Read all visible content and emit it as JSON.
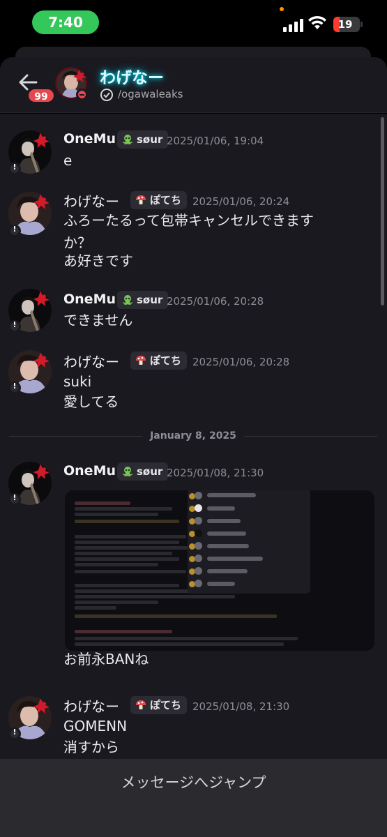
{
  "status_bar": {
    "time": "7:40",
    "battery": "19"
  },
  "header": {
    "back_badge": "99",
    "name": "わげなー",
    "handle": "/ogawaleaks"
  },
  "messages": [
    {
      "user": "OneMu",
      "tag": "søur",
      "timestamp": "2025/01/06, 19:04",
      "lines": [
        "e"
      ]
    },
    {
      "user": "わげなー",
      "tag": "ぽてち",
      "timestamp": "2025/01/06, 20:24",
      "lines": [
        "ふろーたるって包帯キャンセルできます",
        "か？",
        "あ好きです"
      ]
    },
    {
      "user": "OneMu",
      "tag": "søur",
      "timestamp": "2025/01/06, 20:28",
      "lines": [
        "できません"
      ]
    },
    {
      "user": "わげなー",
      "tag": "ぽてち",
      "timestamp": "2025/01/06, 20:28",
      "lines": [
        "suki",
        "愛してる"
      ]
    },
    {
      "user": "OneMu",
      "tag": "søur",
      "timestamp": "2025/01/08, 21:30",
      "lines": [
        "お前永BANね"
      ]
    },
    {
      "user": "わげなー",
      "tag": "ぽてち",
      "timestamp": "2025/01/08, 21:30",
      "lines": [
        "GOMENN",
        "消すから"
      ]
    }
  ],
  "date_divider": "January 8, 2025",
  "jump_button": "メッセージへジャンプ",
  "colors": {
    "accent_red": "#e5484d",
    "name_glow": "#00e5ff",
    "status_green": "#34c759"
  }
}
